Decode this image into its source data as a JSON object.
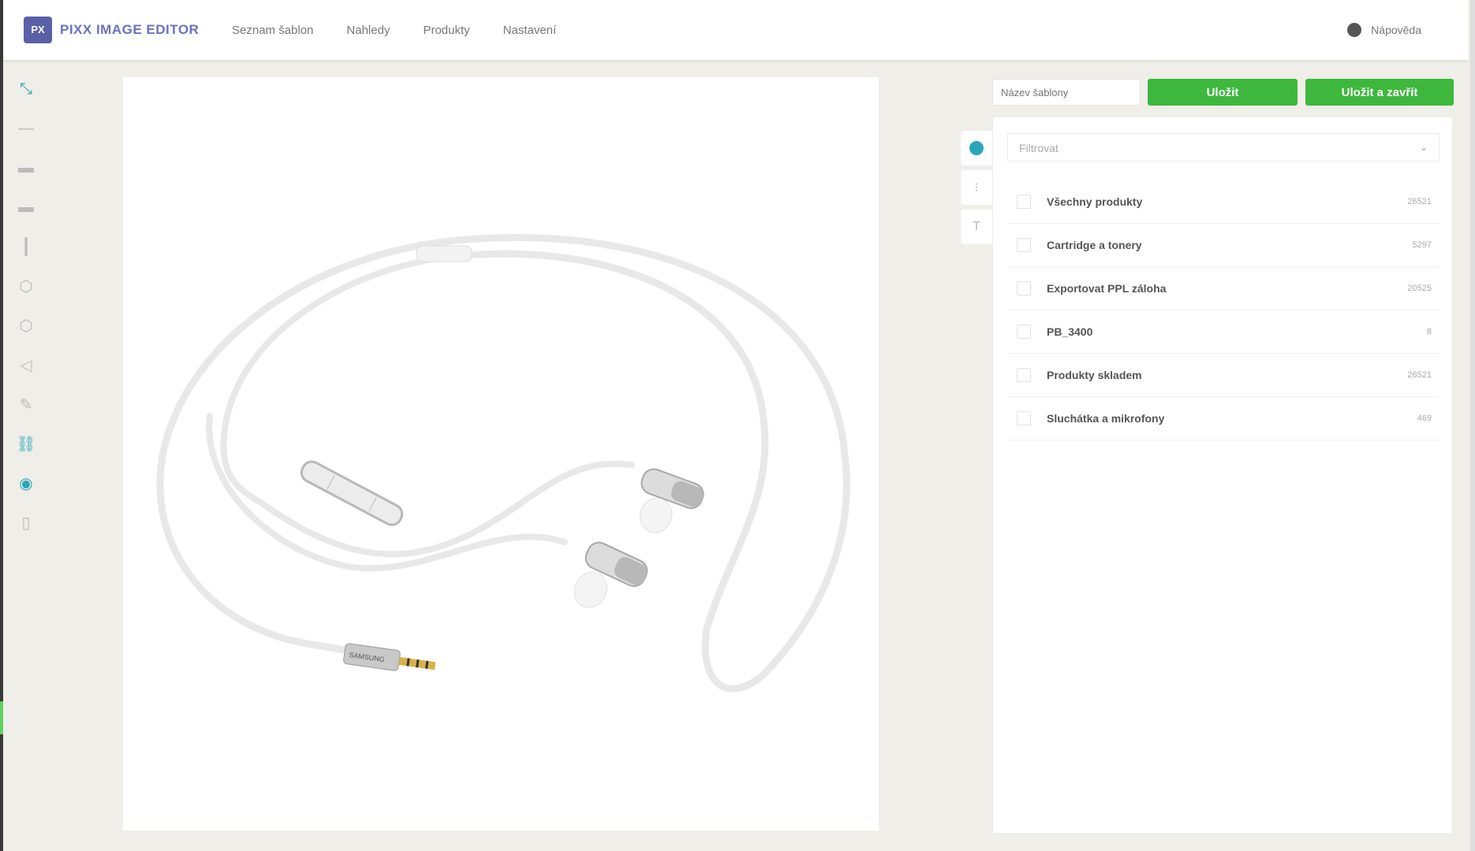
{
  "app": {
    "logo_icon": "PX",
    "logo_text": "PIXX IMAGE EDITOR"
  },
  "nav": {
    "items": [
      "Seznam šablon",
      "Nahledy",
      "Produkty",
      "Nastavení"
    ]
  },
  "user": {
    "name": "Nápověda",
    "icon": "user-icon"
  },
  "tools": [
    {
      "name": "select-tool-icon",
      "glyph": "⤡",
      "active": true
    },
    {
      "name": "line-thin-icon",
      "glyph": "—",
      "active": false
    },
    {
      "name": "line-medium-icon",
      "glyph": "▬",
      "active": false
    },
    {
      "name": "line-thick-icon",
      "glyph": "▬",
      "active": false
    },
    {
      "name": "vertical-line-icon",
      "glyph": "┃",
      "active": false
    },
    {
      "name": "hexagon-icon",
      "glyph": "⬡",
      "active": false
    },
    {
      "name": "hexagon-alt-icon",
      "glyph": "⬡",
      "active": false
    },
    {
      "name": "share-icon",
      "glyph": "◁",
      "active": false
    },
    {
      "name": "pen-icon",
      "glyph": "✎",
      "active": false
    },
    {
      "name": "link-icon",
      "glyph": "⛓",
      "active": true
    },
    {
      "name": "eye-icon",
      "glyph": "◉",
      "active": true
    },
    {
      "name": "layer-icon",
      "glyph": "▯",
      "active": false
    }
  ],
  "toolbar": {
    "name_placeholder": "Název šablony",
    "save_label": "Uložit",
    "save_close_label": "Uložit a zavřít"
  },
  "side_tabs": [
    {
      "name": "tab-visibility",
      "glyph": "",
      "active": true
    },
    {
      "name": "tab-layers",
      "glyph": "⁝",
      "active": false
    },
    {
      "name": "tab-text",
      "glyph": "T",
      "active": false
    }
  ],
  "panel": {
    "filter_placeholder": "Filtrovat",
    "items": [
      {
        "label": "Všechny produkty",
        "count": "26521"
      },
      {
        "label": "Cartridge a tonery",
        "count": "5297"
      },
      {
        "label": "Exportovat PPL záloha",
        "count": "20525"
      },
      {
        "label": "PB_3400",
        "count": "8"
      },
      {
        "label": "Produkty skladem",
        "count": "26521"
      },
      {
        "label": "Sluchátka a mikrofony",
        "count": "469"
      }
    ]
  },
  "canvas": {
    "image_label": "SAMSUNG"
  }
}
